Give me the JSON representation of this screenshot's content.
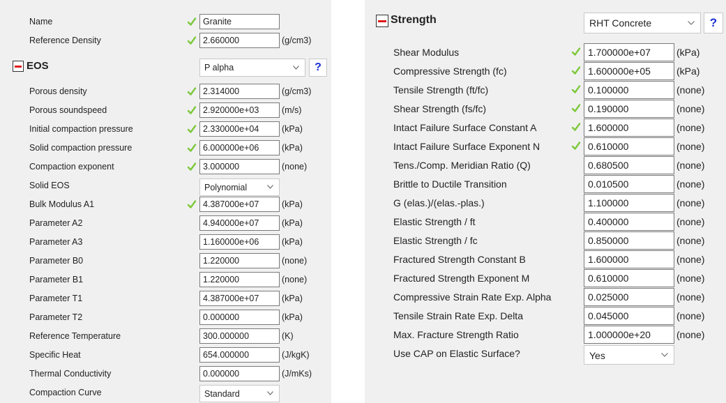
{
  "left": {
    "name": {
      "label": "Name",
      "value": "Granite"
    },
    "ref_density": {
      "label": "Reference Density",
      "value": "2.660000",
      "unit": "(g/cm3)"
    },
    "eos": {
      "title": "EOS",
      "selected": "P alpha",
      "help": "?"
    },
    "rows": [
      {
        "label": "Porous density",
        "value": "2.314000",
        "unit": "(g/cm3)"
      },
      {
        "label": "Porous soundspeed",
        "value": "2.920000e+03",
        "unit": "(m/s)"
      },
      {
        "label": "Initial compaction pressure",
        "value": "2.330000e+04",
        "unit": "(kPa)"
      },
      {
        "label": "Solid compaction pressure",
        "value": "6.000000e+06",
        "unit": "(kPa)"
      },
      {
        "label": "Compaction exponent",
        "value": "3.000000",
        "unit": "(none)"
      },
      {
        "label": "Solid EOS",
        "selected": "Polynomial"
      },
      {
        "label": "Bulk Modulus A1",
        "value": "4.387000e+07",
        "unit": "(kPa)"
      },
      {
        "label": "Parameter A2",
        "value": "4.940000e+07",
        "unit": "(kPa)"
      },
      {
        "label": "Parameter A3",
        "value": "1.160000e+06",
        "unit": "(kPa)"
      },
      {
        "label": "Parameter B0",
        "value": "1.220000",
        "unit": "(none)"
      },
      {
        "label": "Parameter B1",
        "value": "1.220000",
        "unit": "(none)"
      },
      {
        "label": "Parameter T1",
        "value": "4.387000e+07",
        "unit": "(kPa)"
      },
      {
        "label": "Parameter T2",
        "value": "0.000000",
        "unit": "(kPa)"
      },
      {
        "label": "Reference Temperature",
        "value": "300.000000",
        "unit": "(K)"
      },
      {
        "label": "Specific Heat",
        "value": "654.000000",
        "unit": "(J/kgK)"
      },
      {
        "label": "Thermal Conductivity",
        "value": "0.000000",
        "unit": "(J/mKs)"
      },
      {
        "label": "Compaction Curve",
        "selected": "Standard"
      }
    ]
  },
  "right": {
    "strength": {
      "title": "Strength",
      "selected": "RHT Concrete",
      "help": "?"
    },
    "rows": [
      {
        "label": "Shear Modulus",
        "value": "1.700000e+07",
        "unit": "(kPa)"
      },
      {
        "label": "Compressive Strength (fc)",
        "value": "1.600000e+05",
        "unit": "(kPa)"
      },
      {
        "label": "Tensile Strength (ft/fc)",
        "value": "0.100000",
        "unit": "(none)"
      },
      {
        "label": "Shear Strength (fs/fc)",
        "value": "0.190000",
        "unit": "(none)"
      },
      {
        "label": "Intact Failure Surface Constant A",
        "value": "1.600000",
        "unit": "(none)"
      },
      {
        "label": "Intact Failure Surface Exponent N",
        "value": "0.610000",
        "unit": "(none)"
      },
      {
        "label": "Tens./Comp. Meridian Ratio (Q)",
        "value": "0.680500",
        "unit": "(none)"
      },
      {
        "label": "Brittle to Ductile Transition",
        "value": "0.010500",
        "unit": "(none)"
      },
      {
        "label": "G (elas.)/(elas.-plas.)",
        "value": "1.100000",
        "unit": "(none)"
      },
      {
        "label": "Elastic Strength / ft",
        "value": "0.400000",
        "unit": "(none)"
      },
      {
        "label": "Elastic Strength / fc",
        "value": "0.850000",
        "unit": "(none)"
      },
      {
        "label": "Fractured Strength Constant B",
        "value": "1.600000",
        "unit": "(none)"
      },
      {
        "label": "Fractured Strength Exponent M",
        "value": "0.610000",
        "unit": "(none)"
      },
      {
        "label": "Compressive Strain Rate Exp. Alpha",
        "value": "0.025000",
        "unit": "(none)"
      },
      {
        "label": "Tensile Strain Rate Exp. Delta",
        "value": "0.045000",
        "unit": "(none)"
      },
      {
        "label": "Max. Fracture Strength Ratio",
        "value": "1.000000e+20",
        "unit": "(none)"
      },
      {
        "label": "Use CAP on Elastic Surface?",
        "selected": "Yes"
      }
    ]
  },
  "icons": {
    "check": "check-icon",
    "collapse": "minus-collapse-icon",
    "dropdown": "chevron-down-icon"
  },
  "colors": {
    "check": "#7cc83a",
    "collapse": "#e01b1b",
    "help": "#1a2fd4"
  }
}
